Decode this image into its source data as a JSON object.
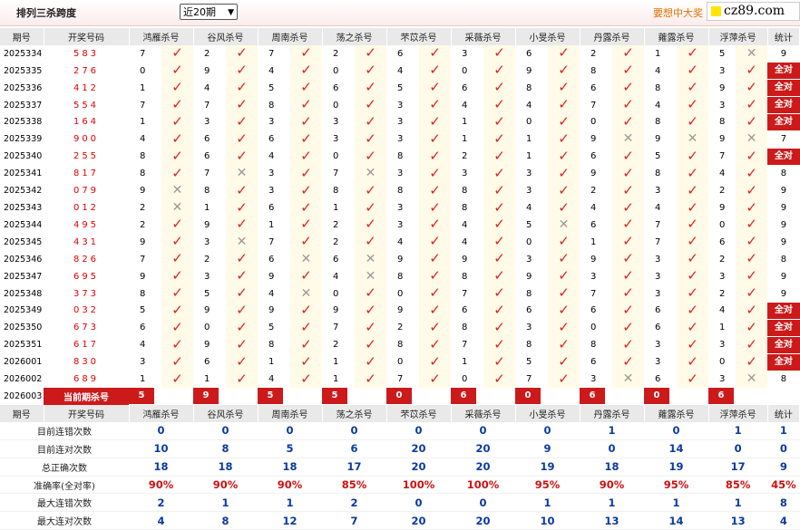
{
  "header": {
    "title": "排列三杀跨度",
    "period_select": "近20期",
    "promo": "要想中大奖",
    "logo": "cz89.com"
  },
  "columns": [
    "期号",
    "开奖号码",
    "鸿雁杀号",
    "谷风杀号",
    "周南杀号",
    "荡之杀号",
    "芣苡杀号",
    "采薇杀号",
    "小旻杀号",
    "丹露杀号",
    "蕹露杀号",
    "浮萍杀号",
    "统计"
  ],
  "rows": [
    {
      "p": "2025334",
      "d": "583",
      "k": [
        [
          "7",
          "c"
        ],
        [
          "2",
          "c"
        ],
        [
          "7",
          "c"
        ],
        [
          "2",
          "c"
        ],
        [
          "6",
          "c"
        ],
        [
          "3",
          "c"
        ],
        [
          "6",
          "c"
        ],
        [
          "2",
          "c"
        ],
        [
          "1",
          "c"
        ],
        [
          "5",
          "x"
        ]
      ],
      "s": "9"
    },
    {
      "p": "2025335",
      "d": "276",
      "k": [
        [
          "0",
          "c"
        ],
        [
          "9",
          "c"
        ],
        [
          "4",
          "c"
        ],
        [
          "0",
          "c"
        ],
        [
          "4",
          "c"
        ],
        [
          "0",
          "c"
        ],
        [
          "9",
          "c"
        ],
        [
          "8",
          "c"
        ],
        [
          "4",
          "c"
        ],
        [
          "3",
          "c"
        ]
      ],
      "s": "全对"
    },
    {
      "p": "2025336",
      "d": "412",
      "k": [
        [
          "1",
          "c"
        ],
        [
          "4",
          "c"
        ],
        [
          "5",
          "c"
        ],
        [
          "6",
          "c"
        ],
        [
          "5",
          "c"
        ],
        [
          "6",
          "c"
        ],
        [
          "8",
          "c"
        ],
        [
          "6",
          "c"
        ],
        [
          "8",
          "c"
        ],
        [
          "9",
          "c"
        ]
      ],
      "s": "全对"
    },
    {
      "p": "2025337",
      "d": "554",
      "k": [
        [
          "7",
          "c"
        ],
        [
          "7",
          "c"
        ],
        [
          "8",
          "c"
        ],
        [
          "0",
          "c"
        ],
        [
          "3",
          "c"
        ],
        [
          "4",
          "c"
        ],
        [
          "4",
          "c"
        ],
        [
          "7",
          "c"
        ],
        [
          "4",
          "c"
        ],
        [
          "3",
          "c"
        ]
      ],
      "s": "全对"
    },
    {
      "p": "2025338",
      "d": "164",
      "k": [
        [
          "1",
          "c"
        ],
        [
          "3",
          "c"
        ],
        [
          "3",
          "c"
        ],
        [
          "3",
          "c"
        ],
        [
          "3",
          "c"
        ],
        [
          "1",
          "c"
        ],
        [
          "0",
          "c"
        ],
        [
          "0",
          "c"
        ],
        [
          "8",
          "c"
        ],
        [
          "8",
          "c"
        ]
      ],
      "s": "全对"
    },
    {
      "p": "2025339",
      "d": "900",
      "k": [
        [
          "4",
          "c"
        ],
        [
          "6",
          "c"
        ],
        [
          "6",
          "c"
        ],
        [
          "3",
          "c"
        ],
        [
          "3",
          "c"
        ],
        [
          "1",
          "c"
        ],
        [
          "1",
          "c"
        ],
        [
          "9",
          "x"
        ],
        [
          "9",
          "x"
        ],
        [
          "9",
          "x"
        ]
      ],
      "s": "7"
    },
    {
      "p": "2025340",
      "d": "255",
      "k": [
        [
          "8",
          "c"
        ],
        [
          "6",
          "c"
        ],
        [
          "4",
          "c"
        ],
        [
          "0",
          "c"
        ],
        [
          "8",
          "c"
        ],
        [
          "2",
          "c"
        ],
        [
          "1",
          "c"
        ],
        [
          "6",
          "c"
        ],
        [
          "5",
          "c"
        ],
        [
          "7",
          "c"
        ]
      ],
      "s": "全对"
    },
    {
      "p": "2025341",
      "d": "817",
      "k": [
        [
          "8",
          "c"
        ],
        [
          "7",
          "x"
        ],
        [
          "3",
          "c"
        ],
        [
          "7",
          "x"
        ],
        [
          "3",
          "c"
        ],
        [
          "3",
          "c"
        ],
        [
          "3",
          "c"
        ],
        [
          "9",
          "c"
        ],
        [
          "8",
          "c"
        ],
        [
          "4",
          "c"
        ]
      ],
      "s": "8"
    },
    {
      "p": "2025342",
      "d": "079",
      "k": [
        [
          "9",
          "x"
        ],
        [
          "8",
          "c"
        ],
        [
          "3",
          "c"
        ],
        [
          "8",
          "c"
        ],
        [
          "8",
          "c"
        ],
        [
          "8",
          "c"
        ],
        [
          "3",
          "c"
        ],
        [
          "2",
          "c"
        ],
        [
          "3",
          "c"
        ],
        [
          "2",
          "c"
        ]
      ],
      "s": "9"
    },
    {
      "p": "2025343",
      "d": "012",
      "k": [
        [
          "2",
          "x"
        ],
        [
          "1",
          "c"
        ],
        [
          "6",
          "c"
        ],
        [
          "1",
          "c"
        ],
        [
          "3",
          "c"
        ],
        [
          "8",
          "c"
        ],
        [
          "4",
          "c"
        ],
        [
          "4",
          "c"
        ],
        [
          "4",
          "c"
        ],
        [
          "9",
          "c"
        ]
      ],
      "s": "9"
    },
    {
      "p": "2025344",
      "d": "495",
      "k": [
        [
          "2",
          "c"
        ],
        [
          "9",
          "c"
        ],
        [
          "1",
          "c"
        ],
        [
          "2",
          "c"
        ],
        [
          "3",
          "c"
        ],
        [
          "4",
          "c"
        ],
        [
          "5",
          "x"
        ],
        [
          "6",
          "c"
        ],
        [
          "7",
          "c"
        ],
        [
          "0",
          "c"
        ]
      ],
      "s": "9"
    },
    {
      "p": "2025345",
      "d": "431",
      "k": [
        [
          "9",
          "c"
        ],
        [
          "3",
          "x"
        ],
        [
          "7",
          "c"
        ],
        [
          "2",
          "c"
        ],
        [
          "4",
          "c"
        ],
        [
          "4",
          "c"
        ],
        [
          "0",
          "c"
        ],
        [
          "1",
          "c"
        ],
        [
          "7",
          "c"
        ],
        [
          "6",
          "c"
        ]
      ],
      "s": "9"
    },
    {
      "p": "2025346",
      "d": "826",
      "k": [
        [
          "7",
          "c"
        ],
        [
          "2",
          "c"
        ],
        [
          "6",
          "x"
        ],
        [
          "6",
          "x"
        ],
        [
          "9",
          "c"
        ],
        [
          "9",
          "c"
        ],
        [
          "3",
          "c"
        ],
        [
          "9",
          "c"
        ],
        [
          "3",
          "c"
        ],
        [
          "2",
          "c"
        ]
      ],
      "s": "8"
    },
    {
      "p": "2025347",
      "d": "695",
      "k": [
        [
          "9",
          "c"
        ],
        [
          "3",
          "c"
        ],
        [
          "9",
          "c"
        ],
        [
          "4",
          "x"
        ],
        [
          "8",
          "c"
        ],
        [
          "8",
          "c"
        ],
        [
          "9",
          "c"
        ],
        [
          "3",
          "c"
        ],
        [
          "3",
          "c"
        ],
        [
          "3",
          "c"
        ]
      ],
      "s": "9"
    },
    {
      "p": "2025348",
      "d": "373",
      "k": [
        [
          "8",
          "c"
        ],
        [
          "5",
          "c"
        ],
        [
          "4",
          "x"
        ],
        [
          "0",
          "c"
        ],
        [
          "0",
          "c"
        ],
        [
          "7",
          "c"
        ],
        [
          "8",
          "c"
        ],
        [
          "7",
          "c"
        ],
        [
          "3",
          "c"
        ],
        [
          "2",
          "c"
        ]
      ],
      "s": "9"
    },
    {
      "p": "2025349",
      "d": "032",
      "k": [
        [
          "5",
          "c"
        ],
        [
          "9",
          "c"
        ],
        [
          "9",
          "c"
        ],
        [
          "9",
          "c"
        ],
        [
          "9",
          "c"
        ],
        [
          "6",
          "c"
        ],
        [
          "6",
          "c"
        ],
        [
          "6",
          "c"
        ],
        [
          "6",
          "c"
        ],
        [
          "4",
          "c"
        ]
      ],
      "s": "全对"
    },
    {
      "p": "2025350",
      "d": "673",
      "k": [
        [
          "6",
          "c"
        ],
        [
          "0",
          "c"
        ],
        [
          "5",
          "c"
        ],
        [
          "7",
          "c"
        ],
        [
          "2",
          "c"
        ],
        [
          "8",
          "c"
        ],
        [
          "3",
          "c"
        ],
        [
          "0",
          "c"
        ],
        [
          "6",
          "c"
        ],
        [
          "1",
          "c"
        ]
      ],
      "s": "全对"
    },
    {
      "p": "2025351",
      "d": "617",
      "k": [
        [
          "4",
          "c"
        ],
        [
          "9",
          "c"
        ],
        [
          "8",
          "c"
        ],
        [
          "2",
          "c"
        ],
        [
          "8",
          "c"
        ],
        [
          "7",
          "c"
        ],
        [
          "8",
          "c"
        ],
        [
          "8",
          "c"
        ],
        [
          "3",
          "c"
        ],
        [
          "3",
          "c"
        ]
      ],
      "s": "全对"
    },
    {
      "p": "2026001",
      "d": "830",
      "k": [
        [
          "3",
          "c"
        ],
        [
          "6",
          "c"
        ],
        [
          "1",
          "c"
        ],
        [
          "1",
          "c"
        ],
        [
          "0",
          "c"
        ],
        [
          "1",
          "c"
        ],
        [
          "5",
          "c"
        ],
        [
          "6",
          "c"
        ],
        [
          "3",
          "c"
        ],
        [
          "0",
          "c"
        ]
      ],
      "s": "全对"
    },
    {
      "p": "2026002",
      "d": "689",
      "k": [
        [
          "1",
          "c"
        ],
        [
          "1",
          "c"
        ],
        [
          "4",
          "c"
        ],
        [
          "1",
          "c"
        ],
        [
          "7",
          "c"
        ],
        [
          "0",
          "c"
        ],
        [
          "7",
          "c"
        ],
        [
          "3",
          "x"
        ],
        [
          "6",
          "c"
        ],
        [
          "3",
          "x"
        ]
      ],
      "s": "8"
    }
  ],
  "current": {
    "p": "2026003",
    "label": "当前期杀号",
    "k": [
      "5",
      "9",
      "5",
      "5",
      "0",
      "6",
      "0",
      "6",
      "0",
      "6"
    ]
  },
  "footer_header": [
    "期号",
    "开奖号码",
    "鸿雁杀号",
    "谷风杀号",
    "周南杀号",
    "荡之杀号",
    "芣苡杀号",
    "采薇杀号",
    "小旻杀号",
    "丹露杀号",
    "蕹露杀号",
    "浮萍杀号",
    "统计"
  ],
  "stats": [
    {
      "label": "目前连错次数",
      "v": [
        "0",
        "0",
        "0",
        "0",
        "0",
        "0",
        "0",
        "1",
        "0",
        "1",
        "1"
      ]
    },
    {
      "label": "目前连对次数",
      "v": [
        "10",
        "8",
        "5",
        "6",
        "20",
        "20",
        "9",
        "0",
        "14",
        "0",
        "0"
      ]
    },
    {
      "label": "总正确次数",
      "v": [
        "18",
        "18",
        "18",
        "17",
        "20",
        "20",
        "19",
        "18",
        "19",
        "17",
        "9"
      ]
    },
    {
      "label": "准确率(全对率)",
      "v": [
        "90%",
        "90%",
        "90%",
        "85%",
        "100%",
        "100%",
        "95%",
        "90%",
        "95%",
        "85%",
        "45%"
      ],
      "pct": true
    },
    {
      "label": "最大连错次数",
      "v": [
        "2",
        "1",
        "1",
        "2",
        "0",
        "0",
        "1",
        "1",
        "1",
        "1",
        "8"
      ]
    },
    {
      "label": "最大连对次数",
      "v": [
        "4",
        "8",
        "12",
        "7",
        "20",
        "20",
        "10",
        "13",
        "14",
        "13",
        "4"
      ]
    }
  ],
  "icons": {
    "check": "check-icon",
    "cross": "cross-icon"
  },
  "colors": {
    "accent": "#cc1a1a",
    "stat_blue": "#0a3aa0",
    "promo": "#e07000"
  }
}
